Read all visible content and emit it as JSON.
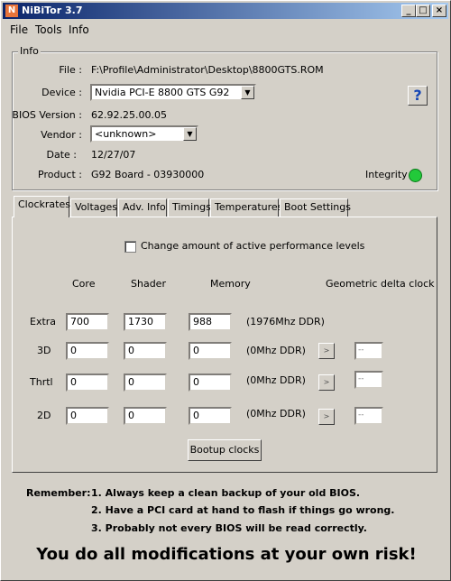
{
  "window": {
    "title": "NiBiTor 3.7",
    "buttons": {
      "minimize": "_",
      "maximize": "□",
      "close": "×"
    }
  },
  "menu": [
    "File",
    "Tools",
    "Info"
  ],
  "info": {
    "group_title": "Info",
    "file_label": "File :",
    "file_value": "F:\\Profile\\Administrator\\Desktop\\8800GTS.ROM",
    "device_label": "Device :",
    "device_value": "Nvidia PCI-E 8800 GTS G92",
    "bios_label": "BIOS Version :",
    "bios_value": "62.92.25.00.05",
    "vendor_label": "Vendor :",
    "vendor_value": "<unknown>",
    "date_label": "Date :",
    "date_value": "12/27/07",
    "product_label": "Product :",
    "product_value": "G92 Board - 03930000",
    "integrity_label": "Integrity :",
    "help_glyph": "?",
    "integrity_color": "#22c93a"
  },
  "tabs": [
    "Clockrates",
    "Voltages",
    "Adv. Info",
    "Timings",
    "Temperatures",
    "Boot Settings"
  ],
  "clockrates": {
    "change_levels_label": "Change amount of active performance levels",
    "headers": {
      "core": "Core",
      "shader": "Shader",
      "memory": "Memory",
      "delta": "Geometric delta clock"
    },
    "rows": [
      {
        "label": "Extra",
        "core": "700",
        "shader": "1730",
        "memory": "988",
        "ddr": "(1976Mhz DDR)",
        "delta": null
      },
      {
        "label": "3D",
        "core": "0",
        "shader": "0",
        "memory": "0",
        "ddr": "(0Mhz DDR)",
        "delta": "--"
      },
      {
        "label": "Thrtl",
        "core": "0",
        "shader": "0",
        "memory": "0",
        "ddr": "(0Mhz DDR)",
        "delta": "--"
      },
      {
        "label": "2D",
        "core": "0",
        "shader": "0",
        "memory": "0",
        "ddr": "(0Mhz DDR)",
        "delta": "--"
      }
    ],
    "bootup_button": "Bootup clocks",
    "step_glyph": ">"
  },
  "remember": {
    "label": "Remember:",
    "lines": [
      "1. Always keep a clean backup of your old BIOS.",
      "2. Have a PCI card at hand to flash if things go wrong.",
      "3. Probably not every BIOS will be read correctly."
    ]
  },
  "warning": "You do all modifications at your own risk!"
}
